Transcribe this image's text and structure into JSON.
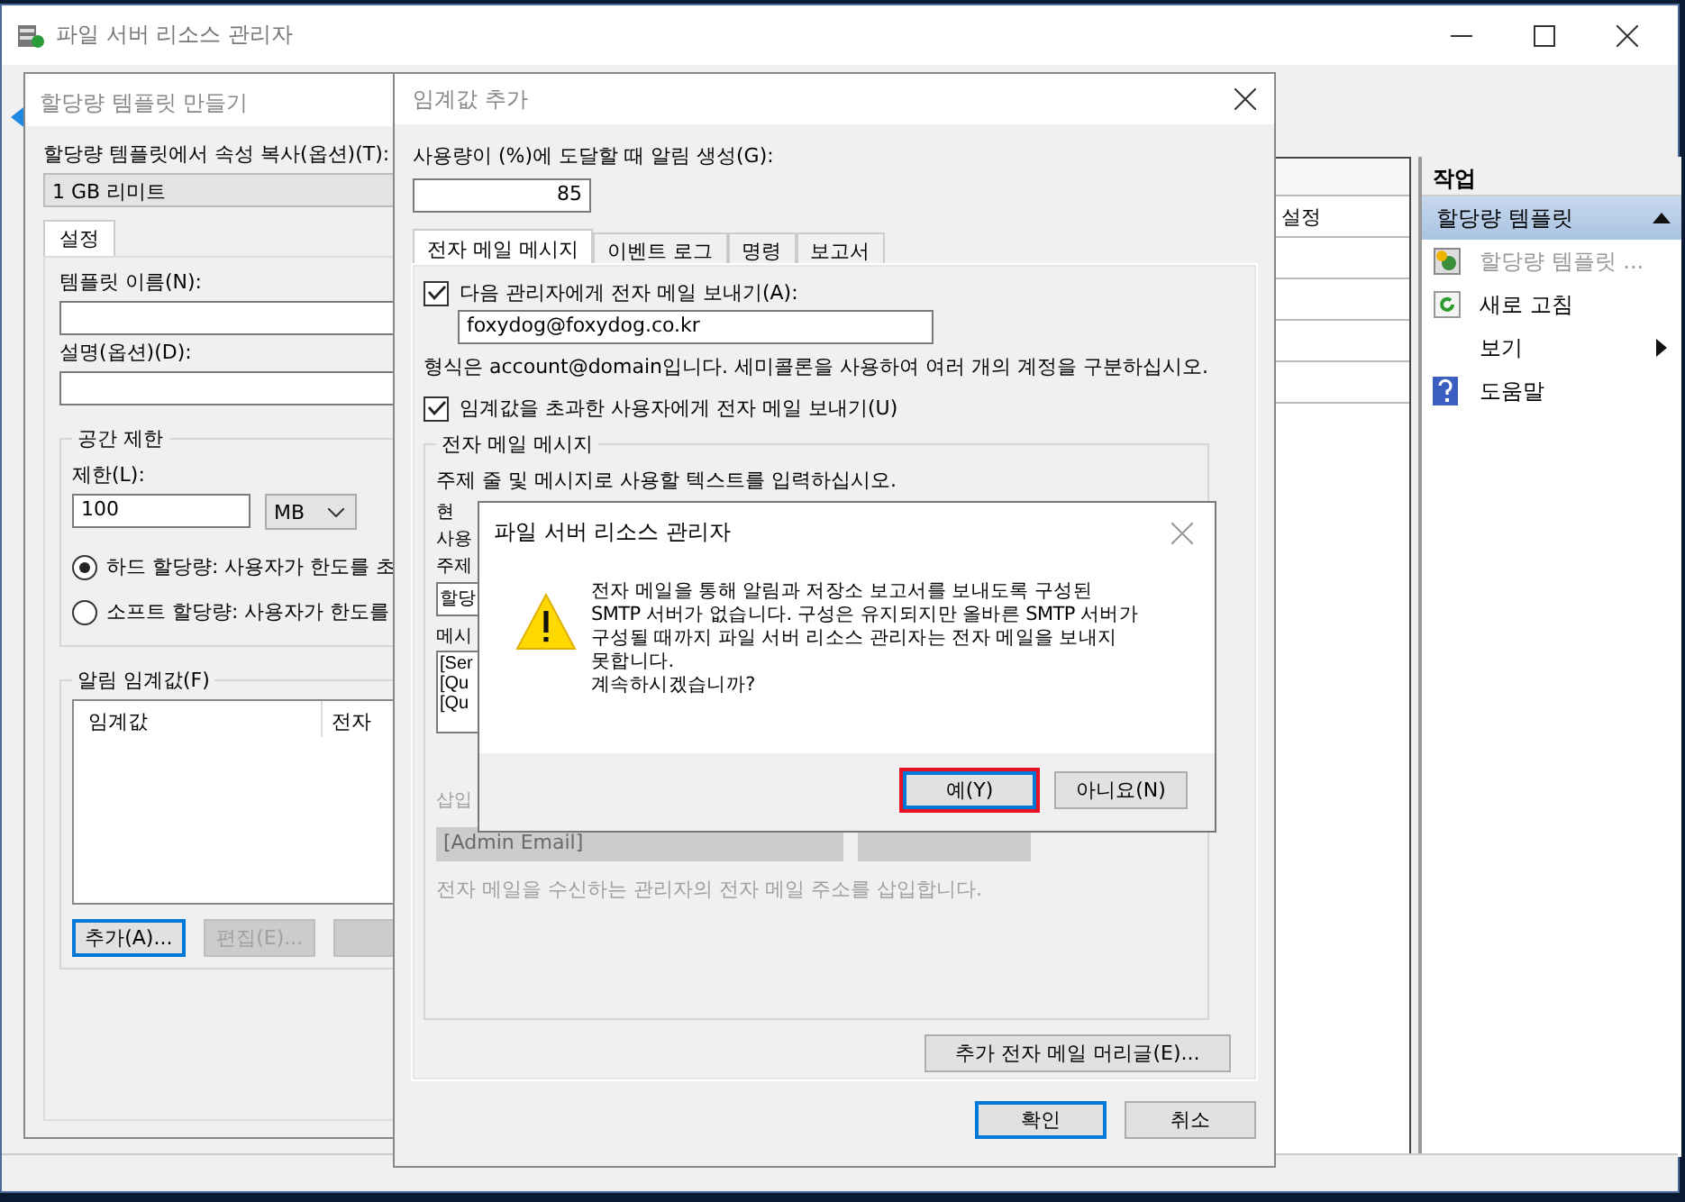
{
  "main_window": {
    "title": "파일 서버 리소스 관리자"
  },
  "list_rows": [
    "설정"
  ],
  "actions_pane": {
    "header": "작업",
    "section": {
      "label": "할당량 템플릿",
      "expanded": true
    },
    "items": [
      {
        "label": "할당량 템플릿 ...",
        "kind": "template",
        "disabled": true,
        "submenu": false
      },
      {
        "label": "새로 고침",
        "kind": "refresh",
        "disabled": false,
        "submenu": false
      },
      {
        "label": "보기",
        "kind": "plain",
        "disabled": false,
        "submenu": true
      },
      {
        "label": "도움말",
        "kind": "help",
        "disabled": false,
        "submenu": false
      }
    ]
  },
  "template_dialog": {
    "title": "할당량 템플릿 만들기",
    "copy_label": "할당량 템플릿에서 속성 복사(옵션)(T):",
    "copy_value": "1 GB 리미트",
    "tab": "설정",
    "name_label": "템플릿 이름(N):",
    "description_label": "설명(옵션)(D):",
    "space_group": "공간 제한",
    "limit_label": "제한(L):",
    "limit_value": "100",
    "unit": "MB",
    "radios": [
      {
        "label": "하드 할당량: 사용자가 한도를 초",
        "selected": true
      },
      {
        "label": "소프트 할당량: 사용자가 한도를 ",
        "selected": false
      }
    ],
    "threshold_group": "알림 임계값(F)",
    "columns": [
      "임계값",
      "전자"
    ],
    "buttons": [
      {
        "label": "추가(A)...",
        "disabled": false,
        "selected": true
      },
      {
        "label": "편집(E)...",
        "disabled": true,
        "selected": false
      },
      {
        "disabled": true,
        "selected": false
      }
    ]
  },
  "threshold_dialog": {
    "title": "임계값 추가",
    "usage_label": "사용량이 (%)에 도달할 때 알림 생성(G):",
    "usage_value": "85",
    "tabs": [
      {
        "label": "전자 메일 메시지",
        "selected": true
      },
      {
        "label": "이벤트 로그",
        "selected": false
      },
      {
        "label": "명령",
        "selected": false
      },
      {
        "label": "보고서",
        "selected": false
      }
    ],
    "send_admin": {
      "label": "다음 관리자에게 전자 메일 보내기(A):",
      "checked": true
    },
    "admin_email": "foxydog@foxydog.co.kr",
    "format_hint": "형식은 account@domain입니다. 세미콜론을 사용하여 여러 개의 계정을 구분하십시오.",
    "send_user": {
      "label": "임계값을 초과한 사용자에게 전자 메일 보내기(U)",
      "checked": true
    },
    "message_group": "전자 메일 메시지",
    "subject_hint": "주제 줄 및 메시지로 사용할 텍스트를 입력하십시오.",
    "covered_labels": [
      "현",
      "사용",
      "주제"
    ],
    "subject_fragment": "할당",
    "message_label_fragment": "메시",
    "message_fragments": [
      "[Ser",
      "[Qu",
      "[Qu"
    ],
    "insert_label_fragment": "삽입",
    "insert_value": "[Admin Email]",
    "insert_hint": "전자 메일을 수신하는 관리자의 전자 메일 주소를 삽입합니다.",
    "headers_button": "추가 전자 메일 머리글(E)...",
    "ok": "확인",
    "cancel": "취소"
  },
  "message_box": {
    "title": "파일 서버 리소스 관리자",
    "lines": [
      "전자 메일을 통해 알림과 저장소 보고서를 보내도록 구성된",
      "SMTP 서버가 없습니다. 구성은 유지되지만 올바른 SMTP 서버가",
      "구성될 때까지 파일 서버 리소스 관리자는 전자 메일을 보내지",
      "못합니다.",
      "계속하시겠습니까?"
    ],
    "buttons": [
      {
        "label": "예(Y)",
        "selected": true
      },
      {
        "label": "아니요(N)",
        "selected": false
      }
    ]
  }
}
